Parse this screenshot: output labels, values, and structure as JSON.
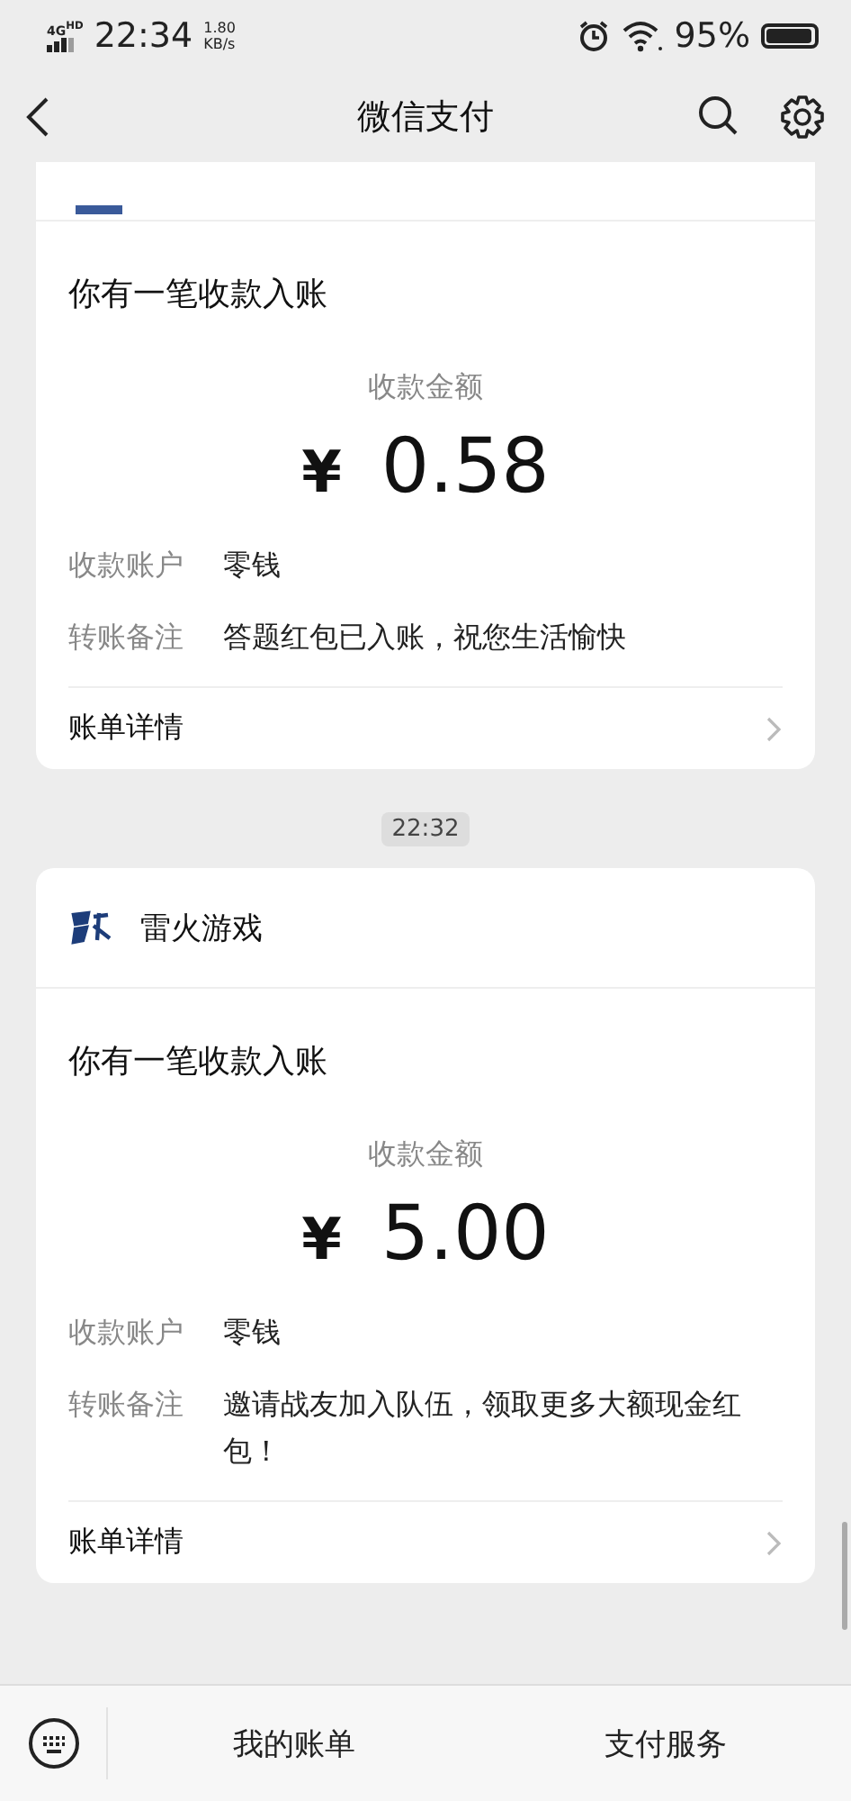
{
  "status_bar": {
    "network": "4G",
    "network_badge": "HD",
    "time": "22:34",
    "speed_value": "1.80",
    "speed_unit": "KB/s",
    "battery": "95%"
  },
  "nav": {
    "title": "微信支付"
  },
  "messages": [
    {
      "kind": "cut",
      "heading": "你有一笔收款入账",
      "amount_label": "收款金额",
      "currency": "¥",
      "amount": "0.58",
      "fields": [
        {
          "label": "收款账户",
          "value": "零钱"
        },
        {
          "label": "转账备注",
          "value": "答题红包已入账，祝您生活愉快"
        }
      ],
      "details": "账单详情"
    },
    {
      "kind": "full",
      "time": "22:32",
      "sender": "雷火游戏",
      "heading": "你有一笔收款入账",
      "amount_label": "收款金额",
      "currency": "¥",
      "amount": "5.00",
      "fields": [
        {
          "label": "收款账户",
          "value": "零钱"
        },
        {
          "label": "转账备注",
          "value": "邀请战友加入队伍，领取更多大额现金红包！"
        }
      ],
      "details": "账单详情"
    }
  ],
  "menu": [
    "我的账单",
    "支付服务"
  ]
}
